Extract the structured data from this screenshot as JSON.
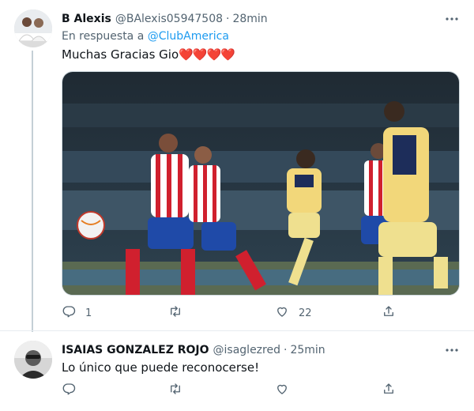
{
  "tweets": [
    {
      "author": "B Alexis",
      "handle": "@BAlexis05947508",
      "separator": "·",
      "time": "28min",
      "reply_prefix": "En respuesta a ",
      "reply_mention": "@ClubAmerica",
      "text": "Muchas Gracias Gio",
      "emoji": "❤️❤️❤️❤️",
      "stats": {
        "replies": "1",
        "retweets": "",
        "likes": "22"
      }
    },
    {
      "author": "ISAIAS GONZALEZ ROJO",
      "handle": "@isaglezred",
      "separator": "·",
      "time": "25min",
      "text": "Lo único que puede reconocerse!",
      "stats": {
        "replies": "",
        "retweets": "",
        "likes": ""
      }
    }
  ],
  "icons": [
    "avatar",
    "more-icon",
    "reply-icon",
    "retweet-icon",
    "like-icon",
    "share-icon"
  ],
  "colors": {
    "link": "#1d9bf0",
    "muted": "#536471",
    "heart": "#e0245e",
    "thread_line": "#c4cfd6"
  }
}
